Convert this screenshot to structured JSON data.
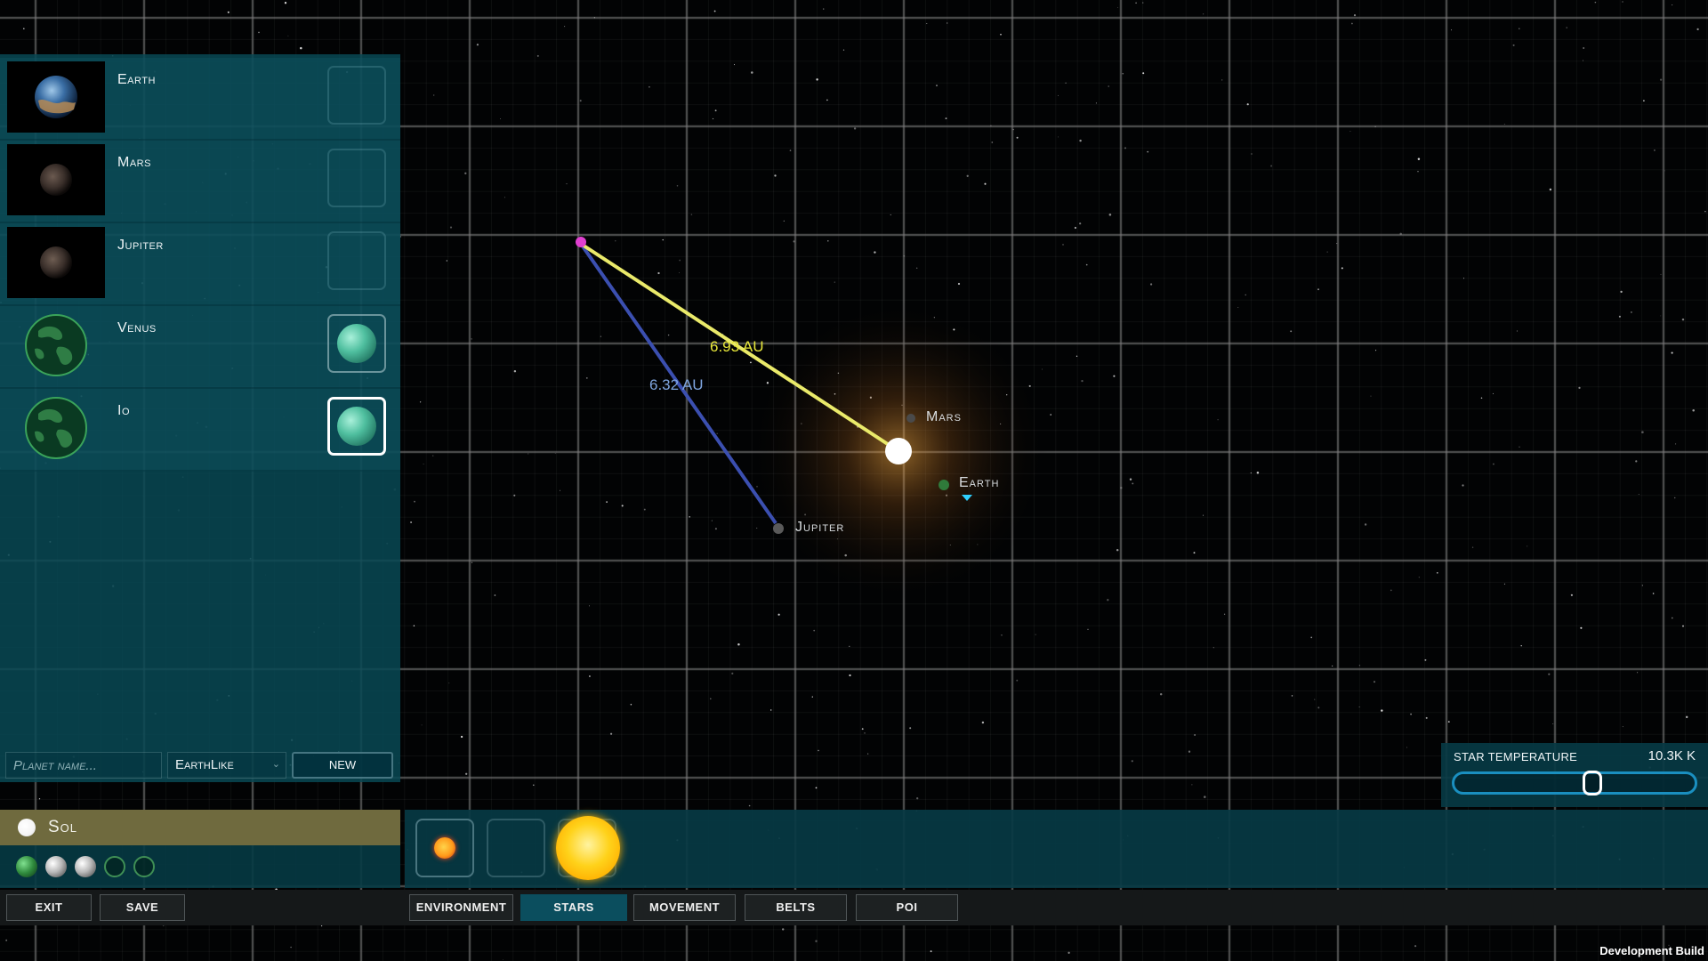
{
  "canvas": {
    "distances": [
      {
        "label": "6.93 AU",
        "color": "#e8e83a"
      },
      {
        "label": "6.32 AU",
        "color": "#7fa6e0"
      }
    ],
    "bodies": {
      "mars": "Mars",
      "earth": "Earth",
      "jupiter": "Jupiter"
    }
  },
  "planet_list": {
    "planets": [
      {
        "name": "Earth",
        "slot": "empty"
      },
      {
        "name": "Mars",
        "slot": "empty"
      },
      {
        "name": "Jupiter",
        "slot": "empty"
      },
      {
        "name": "Venus",
        "slot": "filled"
      },
      {
        "name": "Io",
        "slot": "selected"
      }
    ],
    "form": {
      "name_placeholder": "Planet name...",
      "type_value": "EarthLike",
      "new_label": "NEW"
    }
  },
  "system": {
    "name": "Sol",
    "bodies": [
      "green",
      "grey",
      "grey",
      "empty",
      "empty"
    ]
  },
  "bottom_bar": {
    "exit_label": "EXIT",
    "save_label": "SAVE",
    "tabs": [
      {
        "label": "ENVIRONMENT",
        "active": false
      },
      {
        "label": "STARS",
        "active": true
      },
      {
        "label": "MOVEMENT",
        "active": false
      },
      {
        "label": "BELTS",
        "active": false
      },
      {
        "label": "POI",
        "active": false
      }
    ]
  },
  "star_temperature": {
    "label": "STAR TEMPERATURE",
    "value": "10.3K K",
    "slider_fraction": 0.58
  },
  "footer": {
    "build_label": "Development Build"
  },
  "colors": {
    "panel": "#084854",
    "active_tab": "#0b4e5e",
    "system_header": "#6f6a3e",
    "slider_track": "#1a8fc0"
  }
}
